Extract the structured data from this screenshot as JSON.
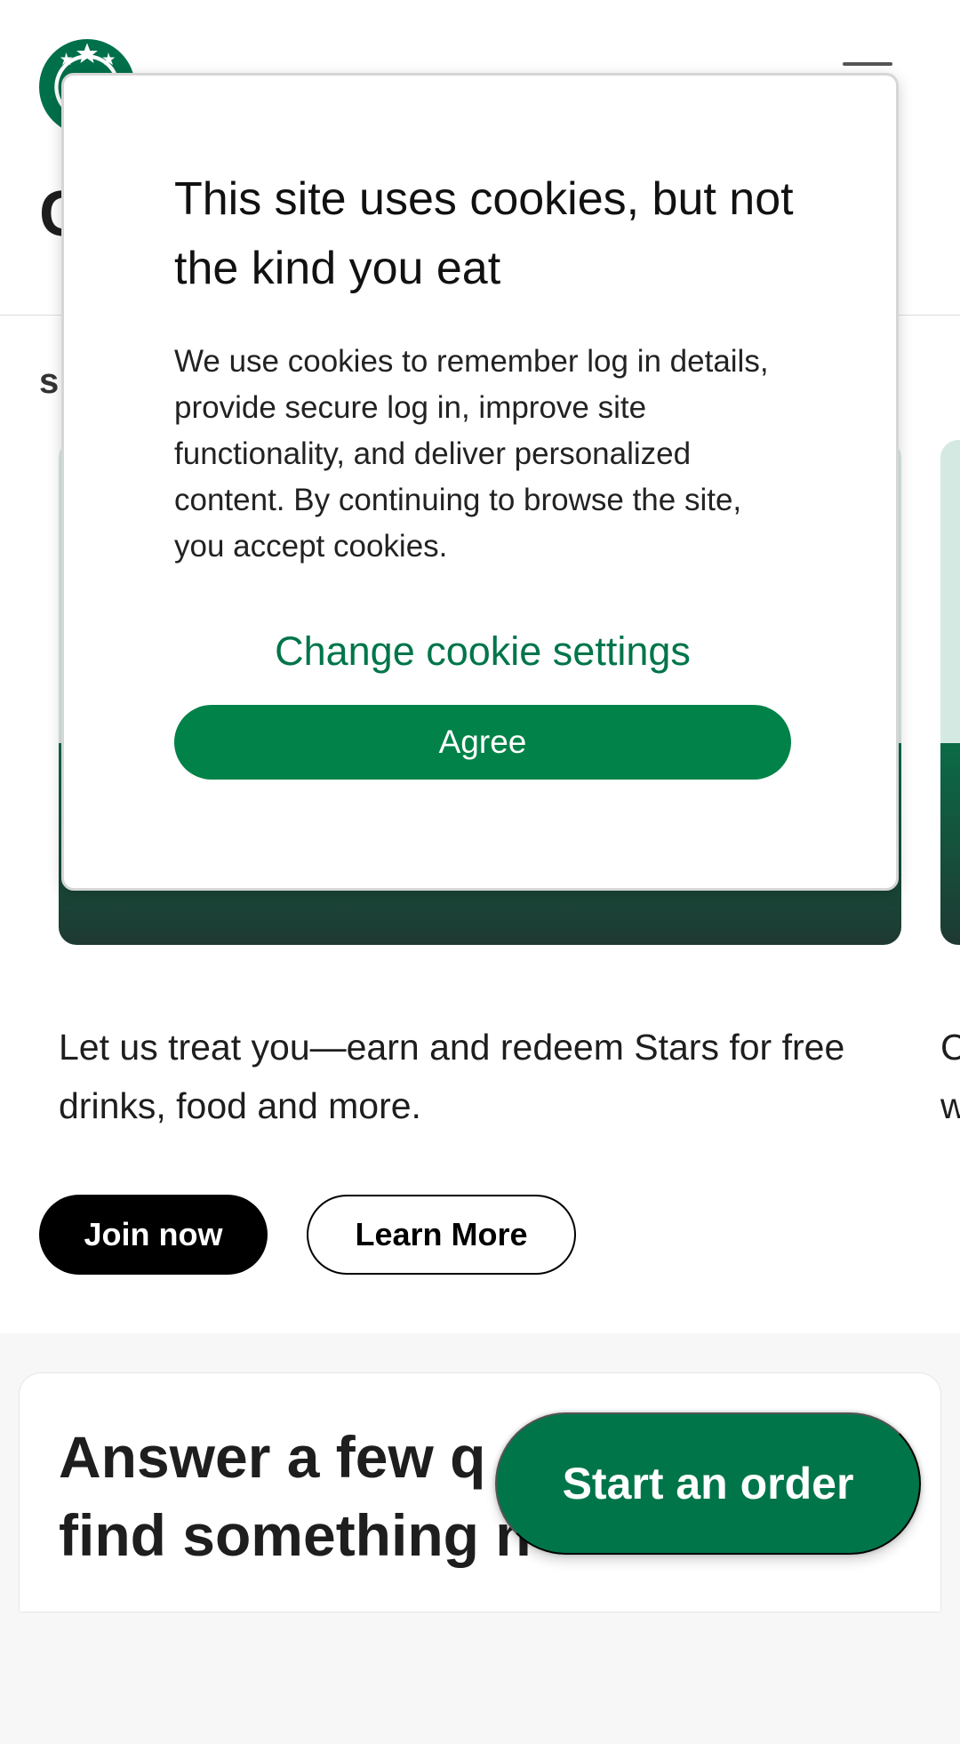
{
  "header": {
    "heading": "C"
  },
  "main": {
    "section_subtitle": "s",
    "rewards_card": {
      "text": "Let us treat you—earn and redeem Stars for free drinks, food and more.",
      "next_card_text": "C w",
      "join_label": "Join now",
      "learn_label": "Learn More"
    },
    "quiz": {
      "title": "Answer a few q\nfind something n"
    }
  },
  "fab": {
    "label": "Start an order"
  },
  "cookie_dialog": {
    "title": "This site uses cookies, but not the kind you eat",
    "body": "We use cookies to remember log in details, provide secure log in, improve site functionality, and deliver personalized content. By continuing to browse the site, you accept cookies.",
    "settings_link": "Change cookie settings",
    "agree_label": "Agree"
  },
  "colors": {
    "brand_green": "#00754a",
    "agree_green": "#008248",
    "house_green": "#1e3932",
    "light_green": "#d4e9e2"
  },
  "icons": {
    "logo": "starbucks-siren-logo",
    "menu": "hamburger-menu-icon"
  }
}
